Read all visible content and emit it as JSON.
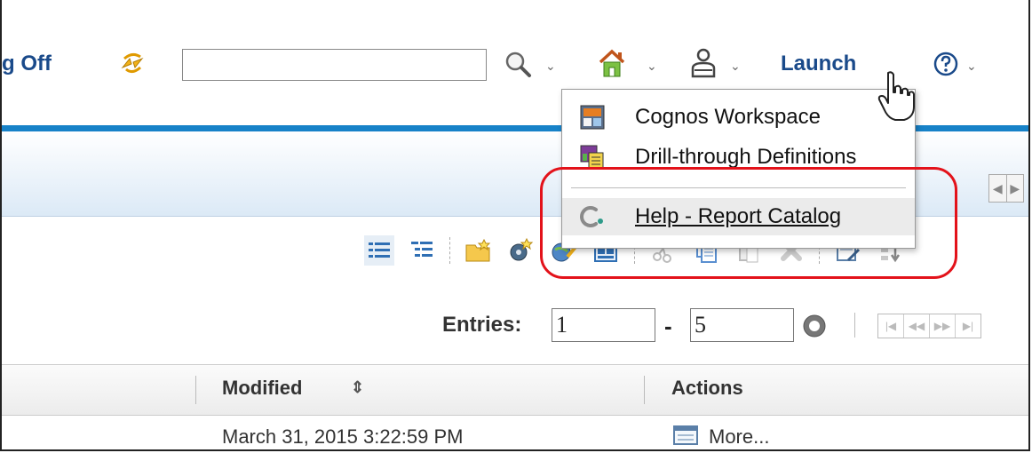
{
  "header": {
    "logoff_label": "g Off",
    "search_value": "",
    "launch_label": "Launch"
  },
  "launch_menu": {
    "items": [
      {
        "label": "Cognos Workspace"
      },
      {
        "label": "Drill-through Definitions"
      },
      {
        "label": "Help - Report Catalog"
      }
    ]
  },
  "entries": {
    "label": "Entries:",
    "from": "1",
    "dash": "-",
    "to": "5"
  },
  "table": {
    "columns": [
      "Modified",
      "Actions"
    ],
    "rows": [
      {
        "modified": "March 31, 2015 3:22:59 PM",
        "action": "More..."
      }
    ]
  },
  "colors": {
    "accent": "#1782c8",
    "highlight_ring": "#e3121a",
    "link": "#1a4a8a"
  }
}
